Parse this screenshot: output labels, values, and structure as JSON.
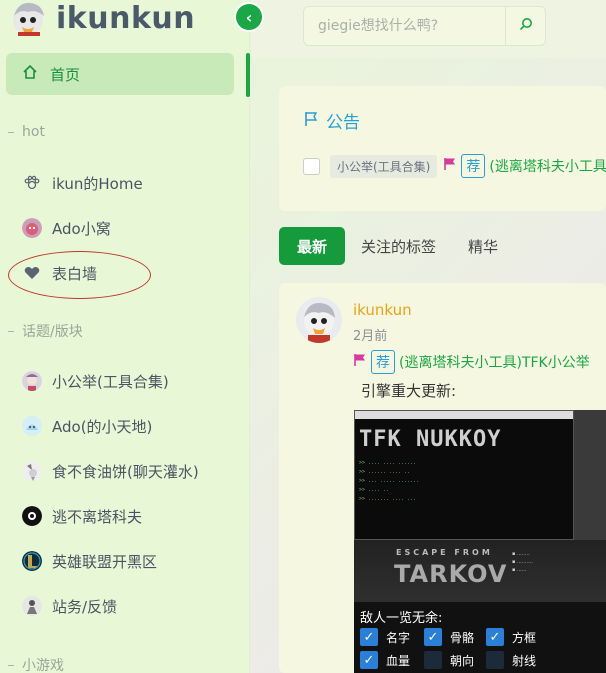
{
  "brand": {
    "title": "ikunkun"
  },
  "nav": {
    "home_label": "首页",
    "sections": [
      {
        "title": "hot"
      },
      {
        "title": "话题/版块"
      },
      {
        "title": "小游戏"
      }
    ],
    "hot_items": [
      {
        "label": "ikun的Home",
        "icon": "paw-icon"
      },
      {
        "label": "Ado小窝",
        "icon": "ado-avatar-icon"
      },
      {
        "label": "表白墙",
        "icon": "heart-icon"
      }
    ],
    "topic_items": [
      {
        "label": "小公举(工具合集)",
        "icon": "topic-avatar-icon"
      },
      {
        "label": "Ado(的小天地)",
        "icon": "ado-topic-icon"
      },
      {
        "label": "食不食油饼(聊天灌水)",
        "icon": "chat-avatar-icon"
      },
      {
        "label": "逃不离塔科夫",
        "icon": "tarkov-icon"
      },
      {
        "label": "英雄联盟开黑区",
        "icon": "lol-icon"
      },
      {
        "label": "站务/反馈",
        "icon": "feedback-icon"
      }
    ]
  },
  "search": {
    "placeholder": "giegie想找什么鸭?"
  },
  "announcement": {
    "title": "公告",
    "category": "小公举(工具合集)",
    "badge": "荐",
    "link": "(逃离塔科夫小工具"
  },
  "tabs": [
    {
      "label": "最新",
      "active": true
    },
    {
      "label": "关注的标签",
      "active": false
    },
    {
      "label": "精华",
      "active": false
    }
  ],
  "post": {
    "author": "ikunkun",
    "time": "2月前",
    "badge": "荐",
    "link": "(逃离塔科夫小工具)TFK小公举",
    "text": "引擎重大更新:",
    "screenshot": {
      "big_text": "TFK NUKKOY",
      "escape_from": "ESCAPE FROM",
      "tarkov": "TARKOV",
      "enemy_title": "敌人一览无余:",
      "options": [
        {
          "label": "名字",
          "checked": true
        },
        {
          "label": "骨骼",
          "checked": true
        },
        {
          "label": "方框",
          "checked": true
        },
        {
          "label": "血量",
          "checked": true
        },
        {
          "label": "朝向",
          "checked": false
        },
        {
          "label": "射线",
          "checked": false
        }
      ]
    }
  },
  "colors": {
    "accent": "#1aa845",
    "announce_blue": "#2a9fd6",
    "author": "#e8a317",
    "annotation": "#c0392b"
  }
}
